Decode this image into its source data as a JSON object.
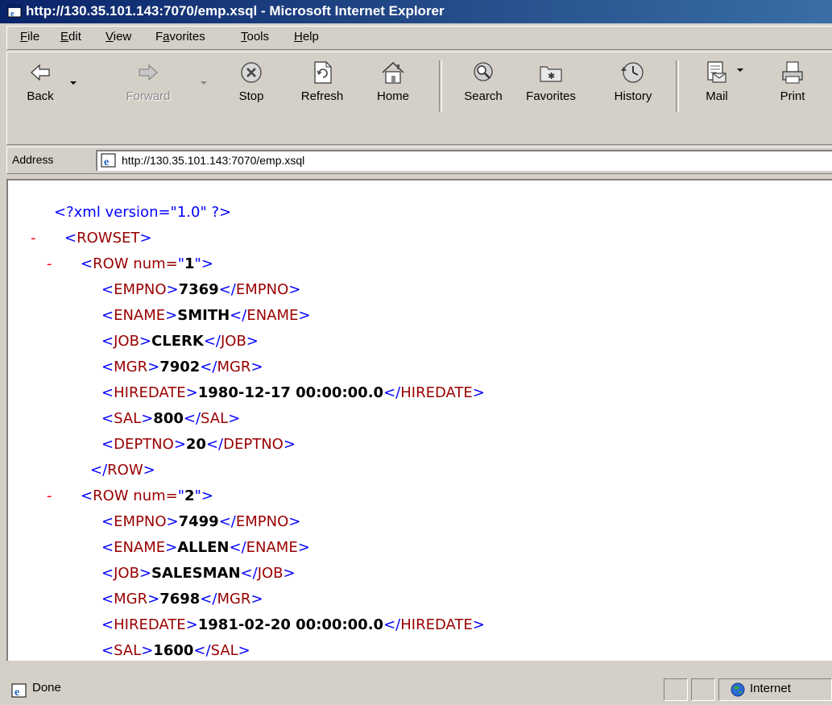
{
  "window": {
    "title": "http://130.35.101.143:7070/emp.xsql - Microsoft Internet Explorer"
  },
  "menu": [
    {
      "label": "File",
      "key": "F",
      "rest": "ile"
    },
    {
      "label": "Edit",
      "key": "E",
      "rest": "dit"
    },
    {
      "label": "View",
      "key": "V",
      "rest": "iew"
    },
    {
      "label": "Favorites",
      "key": "a",
      "pre": "F",
      "rest": "vorites"
    },
    {
      "label": "Tools",
      "key": "T",
      "rest": "ools"
    },
    {
      "label": "Help",
      "key": "H",
      "rest": "elp"
    }
  ],
  "toolbar": {
    "back": "Back",
    "forward": "Forward",
    "stop": "Stop",
    "refresh": "Refresh",
    "home": "Home",
    "search": "Search",
    "favorites": "Favorites",
    "history": "History",
    "mail": "Mail",
    "print": "Print"
  },
  "address": {
    "label": "Address",
    "url": "http://130.35.101.143:7070/emp.xsql"
  },
  "xml": {
    "declaration": "<?xml version=\"1.0\" ?>",
    "rowset_tag": "ROWSET",
    "row_tag": "ROW",
    "row_attr": "num",
    "collapse_marker": "-",
    "rows": [
      {
        "num": "1",
        "fields": [
          {
            "tag": "EMPNO",
            "value": "7369"
          },
          {
            "tag": "ENAME",
            "value": "SMITH"
          },
          {
            "tag": "JOB",
            "value": "CLERK"
          },
          {
            "tag": "MGR",
            "value": "7902"
          },
          {
            "tag": "HIREDATE",
            "value": "1980-12-17 00:00:00.0"
          },
          {
            "tag": "SAL",
            "value": "800"
          },
          {
            "tag": "DEPTNO",
            "value": "20"
          }
        ],
        "closed": true
      },
      {
        "num": "2",
        "fields": [
          {
            "tag": "EMPNO",
            "value": "7499"
          },
          {
            "tag": "ENAME",
            "value": "ALLEN"
          },
          {
            "tag": "JOB",
            "value": "SALESMAN"
          },
          {
            "tag": "MGR",
            "value": "7698"
          },
          {
            "tag": "HIREDATE",
            "value": "1981-02-20 00:00:00.0"
          },
          {
            "tag": "SAL",
            "value": "1600"
          }
        ],
        "closed": false
      }
    ]
  },
  "status": {
    "text": "Done",
    "zone": "Internet"
  },
  "colors": {
    "tag": "#990000",
    "bracket": "#0000ff",
    "collapse": "#ff0000",
    "title_gradient_start": "#0a246a",
    "title_gradient_end": "#3a6ea5"
  }
}
